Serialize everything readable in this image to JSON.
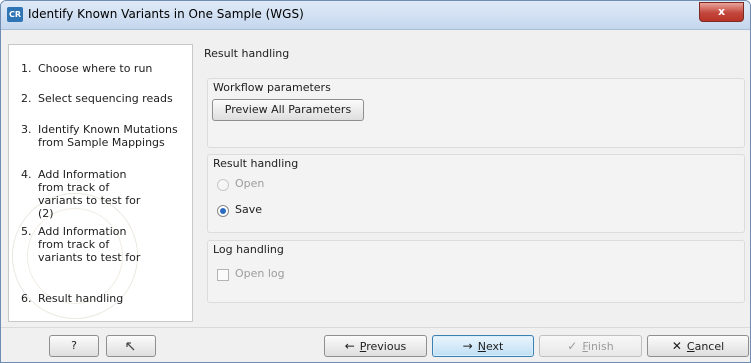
{
  "window": {
    "app_icon": "CR",
    "title": "Identify Known Variants in One Sample (WGS)",
    "close_glyph": "x"
  },
  "steps": [
    {
      "num": "1.",
      "label": "Choose where to run"
    },
    {
      "num": "2.",
      "label": "Select sequencing reads"
    },
    {
      "num": "3.",
      "label": "Identify Known Mutations from Sample Mappings"
    },
    {
      "num": "4.",
      "label": "Add Information from track of variants to test for (2)"
    },
    {
      "num": "5.",
      "label": "Add Information from track of variants to test for"
    },
    {
      "num": "6.",
      "label": "Result handling"
    }
  ],
  "main": {
    "section_title": "Result handling",
    "workflow_group": {
      "title": "Workflow parameters",
      "preview_button": "Preview All Parameters"
    },
    "result_group": {
      "title": "Result handling",
      "open_label": "Open",
      "save_label": "Save",
      "selected": "Save"
    },
    "log_group": {
      "title": "Log handling",
      "open_log_label": "Open log",
      "open_log_checked": false
    }
  },
  "footer": {
    "help_label": "?",
    "restore_icon": "restore-defaults-icon",
    "previous": {
      "arrow": "←",
      "mnemonic": "P",
      "rest": "revious"
    },
    "next": {
      "arrow": "→",
      "mnemonic": "N",
      "rest": "ext"
    },
    "finish": {
      "check": "✓",
      "mnemonic": "F",
      "rest": "inish"
    },
    "cancel": {
      "x": "✕",
      "mnemonic": "C",
      "rest": "ancel"
    }
  }
}
